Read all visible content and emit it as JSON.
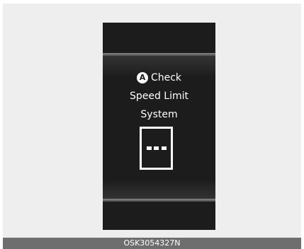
{
  "cluster_display": {
    "marker_label": "A",
    "message_lines": [
      "Check",
      "Speed Limit",
      "System"
    ],
    "sign_placeholder": "- - -"
  },
  "caption": "OSK3054327N",
  "colors": {
    "background": "#eeeeee",
    "screen": "#1c1c1c",
    "text": "#ffffff",
    "caption_bar": "#6e6e6e"
  }
}
